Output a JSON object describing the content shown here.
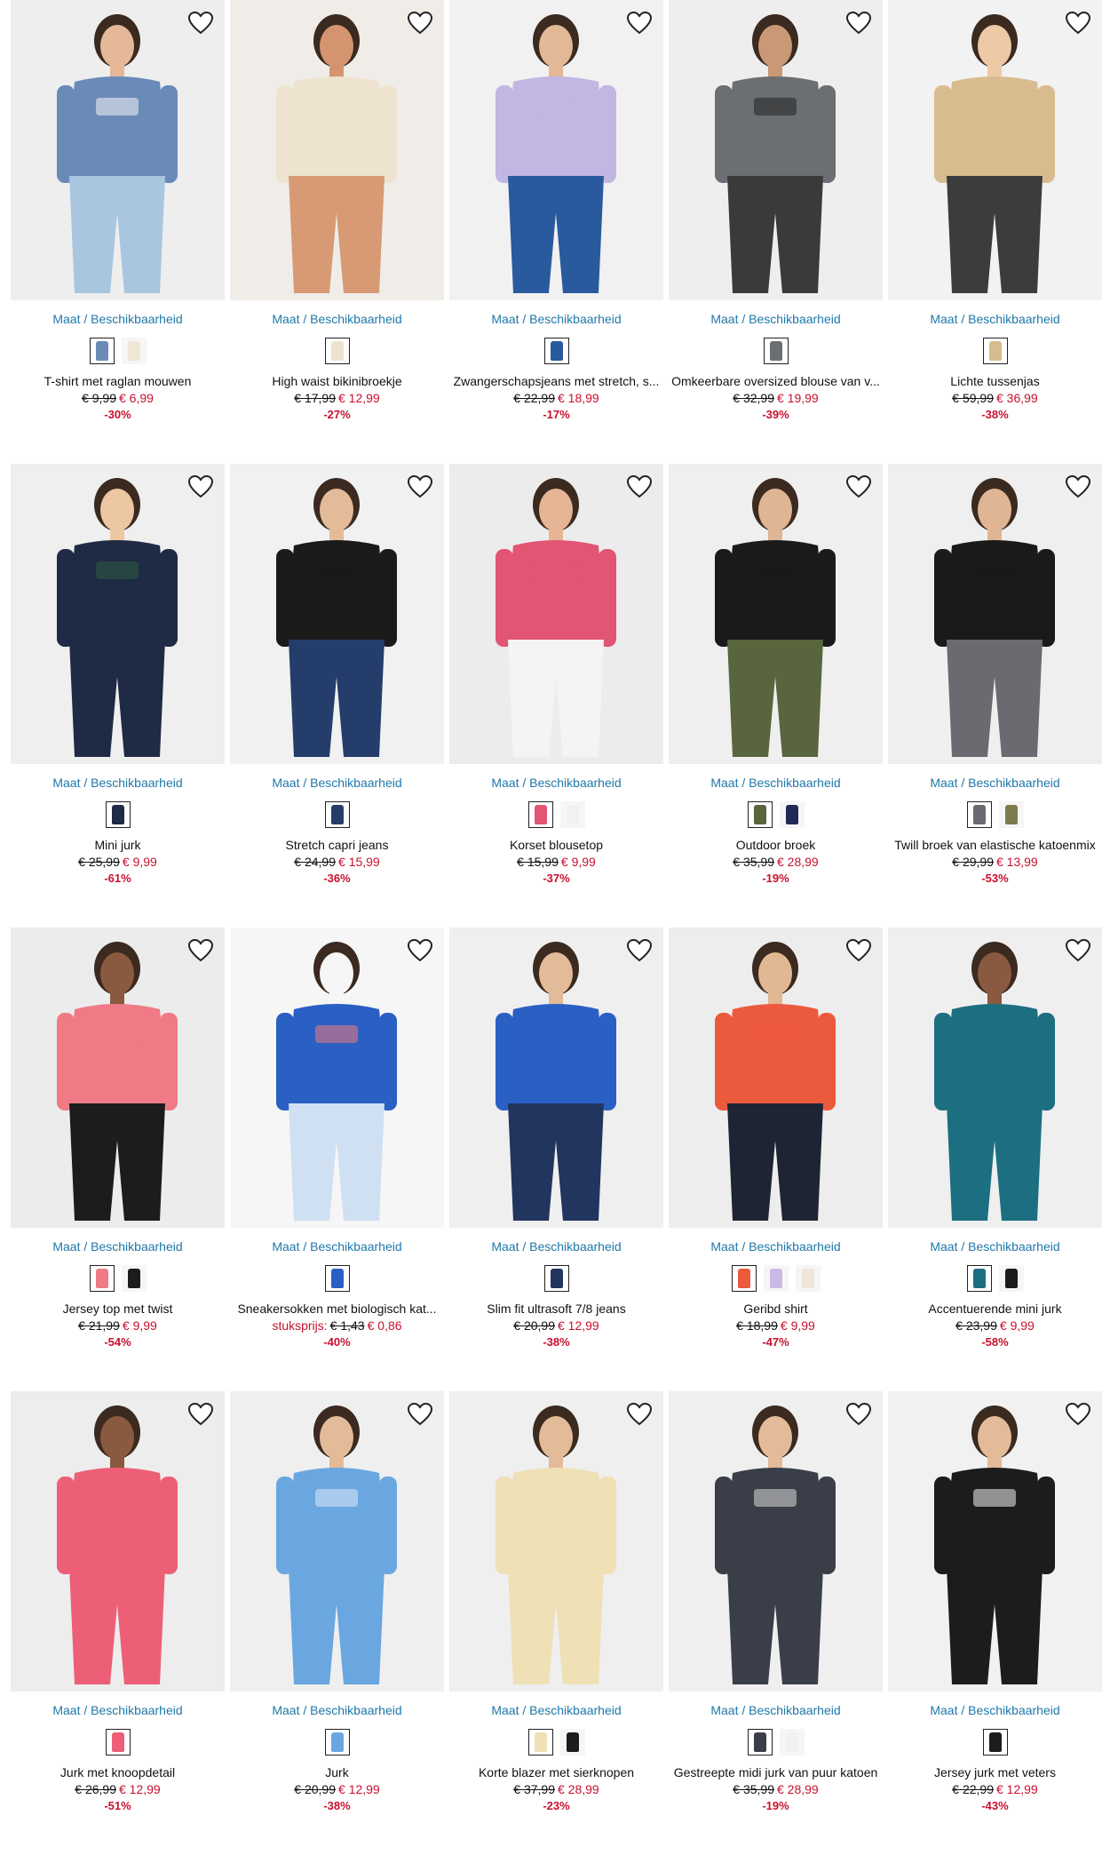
{
  "labels": {
    "size_link": "Maat / Beschikbaarheid",
    "favorite_icon": "heart-outline-icon"
  },
  "products": [
    {
      "title": "T-shirt met raglan mouwen",
      "old_price": "€ 9,99",
      "new_price": "€ 6,99",
      "discount": "-30%",
      "bg": "#eeeeee",
      "main": "#6a8bb8",
      "accent": "#f4f4f4",
      "bottom": "#a9c6e0",
      "skin": "#e5b897",
      "swatches": [
        "#6a8bb8",
        "#efe7d6"
      ]
    },
    {
      "title": "High waist bikinibroekje",
      "old_price": "€ 17,99",
      "new_price": "€ 12,99",
      "discount": "-27%",
      "bg": "#f0ece8",
      "main": "#ede3cf",
      "accent": "#ede3cf",
      "bottom": "#d79a74",
      "skin": "#d59470",
      "swatches": [
        "#ede3cf"
      ]
    },
    {
      "title": "Zwangerschapsjeans met stretch, s...",
      "old_price": "€ 22,99",
      "new_price": "€ 18,99",
      "discount": "-17%",
      "bg": "#f1f1f1",
      "main": "#c2b6e2",
      "accent": "#c2b6e2",
      "bottom": "#2a5a9e",
      "skin": "#e2b897",
      "swatches": [
        "#2a5a9e"
      ]
    },
    {
      "title": "Omkeerbare oversized blouse van v...",
      "old_price": "€ 32,99",
      "new_price": "€ 19,99",
      "discount": "-39%",
      "bg": "#eeeeee",
      "main": "#6b6e72",
      "accent": "#222222",
      "bottom": "#3a3a3a",
      "skin": "#c99874",
      "swatches": [
        "#6b6e72"
      ]
    },
    {
      "title": "Lichte tussenjas",
      "old_price": "€ 59,99",
      "new_price": "€ 36,99",
      "discount": "-38%",
      "bg": "#f2f2f2",
      "main": "#d8bc8f",
      "accent": "#d8bc8f",
      "bottom": "#3c3c3c",
      "skin": "#edc9a6",
      "swatches": [
        "#d8bc8f"
      ]
    },
    {
      "title": "Mini jurk",
      "old_price": "€ 25,99",
      "new_price": "€ 9,99",
      "discount": "-61%",
      "bg": "#efefef",
      "main": "#1f2a44",
      "accent": "#2b5b43",
      "bottom": "#1f2a44",
      "skin": "#edc6a2",
      "swatches": [
        "#1f2a44"
      ]
    },
    {
      "title": "Stretch capri jeans",
      "old_price": "€ 24,99",
      "new_price": "€ 15,99",
      "discount": "-36%",
      "bg": "#f1f1f1",
      "main": "#1a1a1a",
      "accent": "#1a1a1a",
      "bottom": "#253d6b",
      "skin": "#e3bb98",
      "swatches": [
        "#253d6b"
      ]
    },
    {
      "title": "Korset blousetop",
      "old_price": "€ 15,99",
      "new_price": "€ 9,99",
      "discount": "-37%",
      "bg": "#ececec",
      "main": "#e25573",
      "accent": "#e25573",
      "bottom": "#f4f4f4",
      "skin": "#e6b593",
      "swatches": [
        "#e25573",
        "#f1f1f1"
      ]
    },
    {
      "title": "Outdoor broek",
      "old_price": "€ 35,99",
      "new_price": "€ 28,99",
      "discount": "-19%",
      "bg": "#efefef",
      "main": "#1a1a1a",
      "accent": "#1a1a1a",
      "bottom": "#58653d",
      "skin": "#e0b593",
      "swatches": [
        "#58653d",
        "#1f2a55"
      ]
    },
    {
      "title": "Twill broek van elastische katoenmix",
      "old_price": "€ 29,99",
      "new_price": "€ 13,99",
      "discount": "-53%",
      "bg": "#efefef",
      "main": "#1a1a1a",
      "accent": "#1a1a1a",
      "bottom": "#6d6970",
      "skin": "#e0b593",
      "swatches": [
        "#6d6970",
        "#7d7a4e"
      ]
    },
    {
      "title": "Jersey top met twist",
      "old_price": "€ 21,99",
      "new_price": "€ 9,99",
      "discount": "-54%",
      "bg": "#ececec",
      "main": "#f07a86",
      "accent": "#f07a86",
      "bottom": "#1c1c1c",
      "skin": "#8a5a40",
      "swatches": [
        "#f07a86",
        "#1c1c1c"
      ]
    },
    {
      "title": "Sneakersokken met biologisch kat...",
      "unit_label": "stuksprijs:",
      "old_price": "€ 1,43",
      "new_price": "€ 0,86",
      "discount": "-40%",
      "bg": "#f6f6f6",
      "main": "#2a5fc4",
      "accent": "#ef7a7a",
      "bottom": "#cfe0f3",
      "skin": "#f6f6f6",
      "swatches": [
        "#2a5fc4"
      ]
    },
    {
      "title": "Slim fit ultrasoft 7/8 jeans",
      "old_price": "€ 20,99",
      "new_price": "€ 12,99",
      "discount": "-38%",
      "bg": "#efefef",
      "main": "#2a5fc4",
      "accent": "#2a5fc4",
      "bottom": "#22355e",
      "skin": "#e3bb98",
      "swatches": [
        "#22355e"
      ]
    },
    {
      "title": "Geribd shirt",
      "old_price": "€ 18,99",
      "new_price": "€ 9,99",
      "discount": "-47%",
      "bg": "#ededed",
      "main": "#ec5a3e",
      "accent": "#ec5a3e",
      "bottom": "#1e2433",
      "skin": "#e2b894",
      "swatches": [
        "#ec5a3e",
        "#c9b9e3",
        "#efe6d8"
      ]
    },
    {
      "title": "Accentuerende mini jurk",
      "old_price": "€ 23,99",
      "new_price": "€ 9,99",
      "discount": "-58%",
      "bg": "#efefef",
      "main": "#1c6f80",
      "accent": "#1c6f80",
      "bottom": "#1c6f80",
      "skin": "#8a5a40",
      "swatches": [
        "#1c6f80",
        "#1c1c1c"
      ]
    },
    {
      "title": "Jurk met knoopdetail",
      "old_price": "€ 26,99",
      "new_price": "€ 12,99",
      "discount": "-51%",
      "bg": "#ededed",
      "main": "#ec5f77",
      "accent": "#ec5f77",
      "bottom": "#ec5f77",
      "skin": "#8a5a40",
      "swatches": [
        "#ec5f77"
      ]
    },
    {
      "title": "Jurk",
      "old_price": "€ 20,99",
      "new_price": "€ 12,99",
      "discount": "-38%",
      "bg": "#efefef",
      "main": "#6aa7e0",
      "accent": "#dbe9f7",
      "bottom": "#6aa7e0",
      "skin": "#e3bb98",
      "swatches": [
        "#6aa7e0"
      ]
    },
    {
      "title": "Korte blazer met sierknopen",
      "old_price": "€ 37,99",
      "new_price": "€ 28,99",
      "discount": "-23%",
      "bg": "#efefef",
      "main": "#efe0b6",
      "accent": "#efe0b6",
      "bottom": "#efe0b6",
      "skin": "#e3bb98",
      "swatches": [
        "#efe0b6",
        "#1c1c1c"
      ]
    },
    {
      "title": "Gestreepte midi jurk van puur katoen",
      "old_price": "€ 35,99",
      "new_price": "€ 28,99",
      "discount": "-19%",
      "bg": "#efefef",
      "main": "#3a3e48",
      "accent": "#d9d9d9",
      "bottom": "#3a3e48",
      "skin": "#e3bb98",
      "swatches": [
        "#3a3e48",
        "#f1f1f1"
      ]
    },
    {
      "title": "Jersey jurk met veters",
      "old_price": "€ 22,99",
      "new_price": "€ 12,99",
      "discount": "-43%",
      "bg": "#f1f1f1",
      "main": "#1c1c1c",
      "accent": "#f4f4f4",
      "bottom": "#1c1c1c",
      "skin": "#e3bb98",
      "swatches": [
        "#1c1c1c"
      ]
    }
  ]
}
